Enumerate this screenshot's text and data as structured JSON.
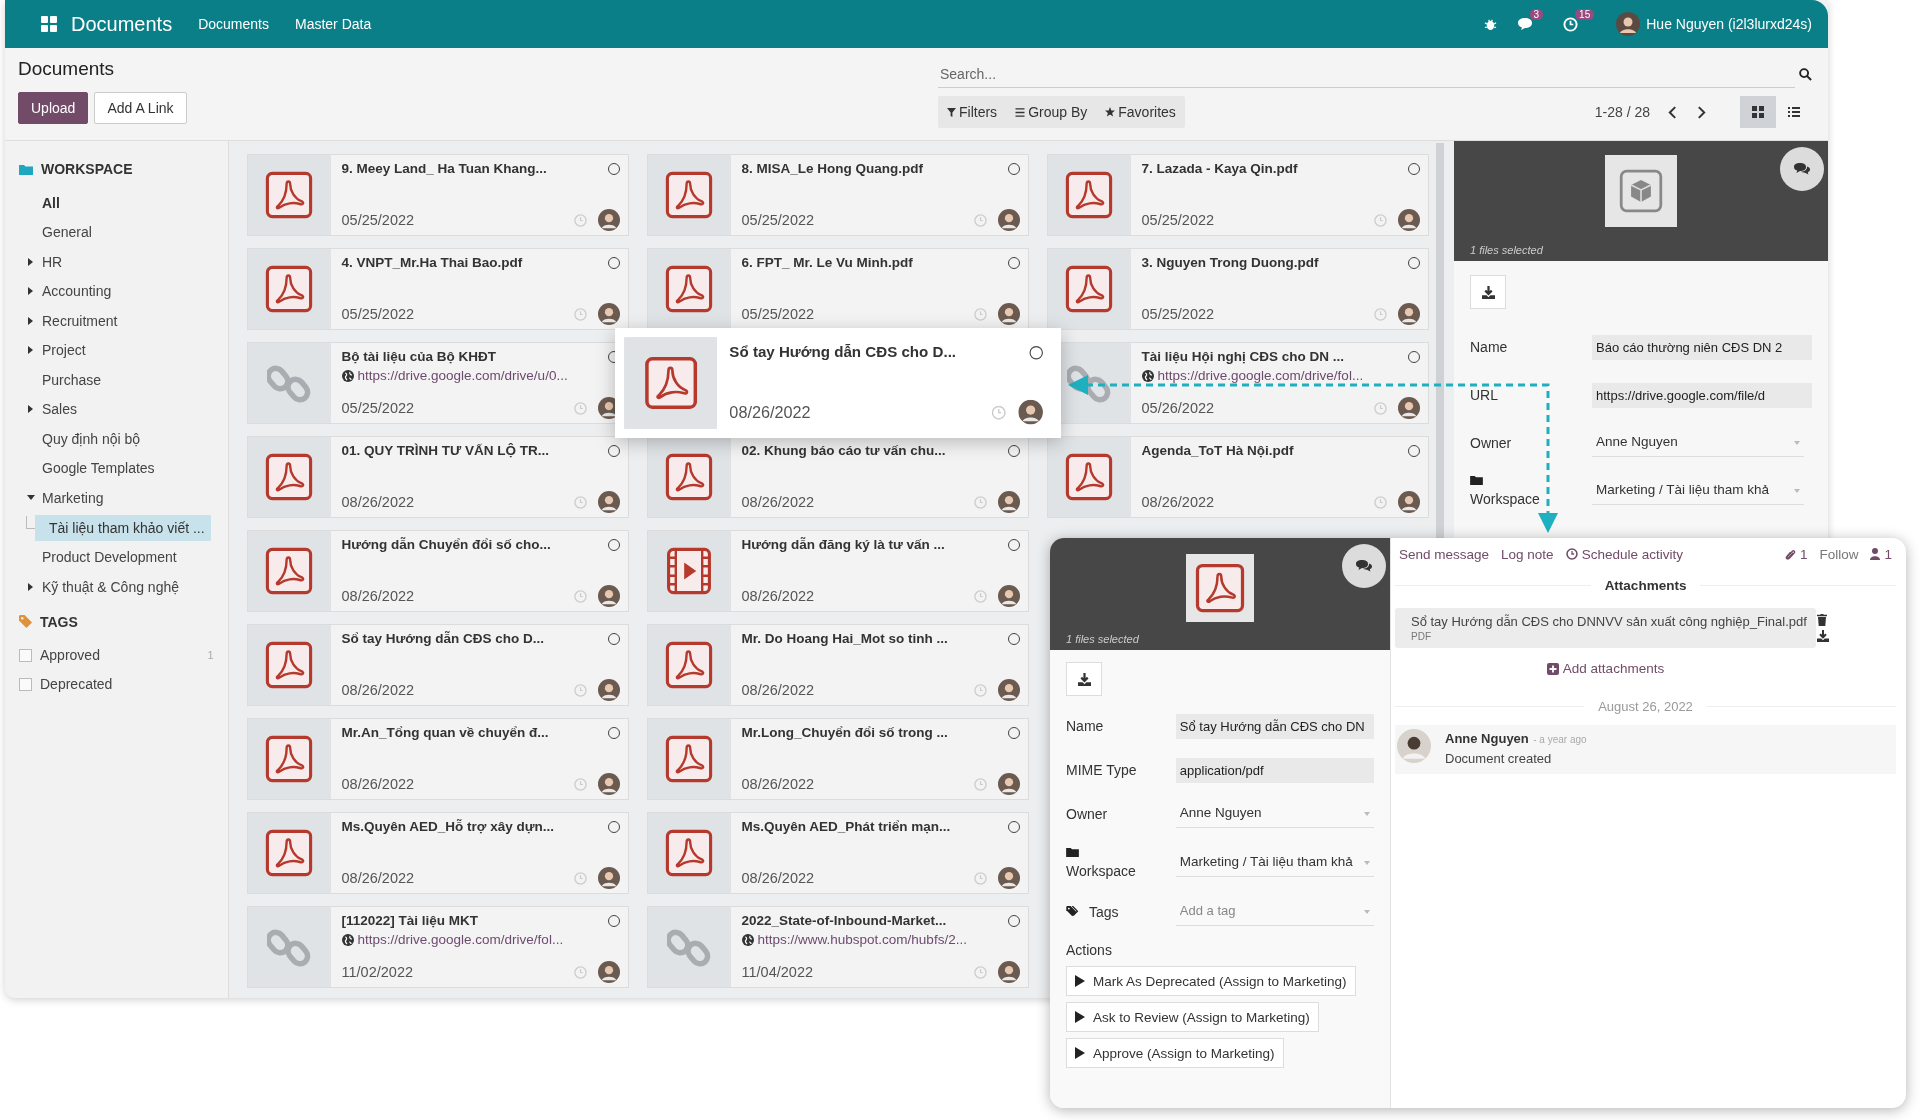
{
  "navbar": {
    "app_name": "Documents",
    "menus": [
      "Documents",
      "Master Data"
    ],
    "messages_count": "3",
    "activities_count": "15",
    "user": "Hue Nguyen (i2l3lurxd24s)"
  },
  "control_panel": {
    "title": "Documents",
    "buttons": [
      {
        "kind": "primary",
        "label": "Upload"
      },
      {
        "kind": "secondary",
        "label": "Add A Link"
      }
    ],
    "search": {
      "placeholder": "Search..."
    },
    "filters": [
      {
        "kind": "filter",
        "label": "Filters"
      },
      {
        "kind": "group",
        "label": "Group By"
      },
      {
        "kind": "star",
        "label": "Favorites"
      }
    ],
    "pager": "1-28 / 28",
    "views": [
      {
        "kind": "kanban",
        "selected": true
      },
      {
        "kind": "list",
        "selected": false
      }
    ]
  },
  "sidebar": {
    "workspace_heading": "WORKSPACE",
    "folders": [
      {
        "label": "All",
        "kind": "all",
        "expanded": false,
        "selected": false
      },
      {
        "label": "General",
        "kind": "leaf",
        "expanded": false,
        "selected": false
      },
      {
        "label": "HR",
        "kind": "group",
        "expanded": false,
        "selected": false
      },
      {
        "label": "Accounting",
        "kind": "group",
        "expanded": false,
        "selected": false
      },
      {
        "label": "Recruitment",
        "kind": "group",
        "expanded": false,
        "selected": false
      },
      {
        "label": "Project",
        "kind": "group",
        "expanded": false,
        "selected": false
      },
      {
        "label": "Purchase",
        "kind": "leaf",
        "expanded": false,
        "selected": false
      },
      {
        "label": "Sales",
        "kind": "group",
        "expanded": false,
        "selected": false
      },
      {
        "label": "Quy định nội bộ",
        "kind": "leaf",
        "expanded": false,
        "selected": false
      },
      {
        "label": "Google Templates",
        "kind": "leaf",
        "expanded": false,
        "selected": false
      },
      {
        "label": "Marketing",
        "kind": "group",
        "expanded": true,
        "selected": false,
        "children": [
          {
            "label": "Tài liệu tham khảo viết ...",
            "selected": true
          }
        ]
      },
      {
        "label": "Product Development",
        "kind": "leaf",
        "expanded": false,
        "selected": false
      },
      {
        "label": "Kỹ thuật & Công nghệ",
        "kind": "group",
        "expanded": false,
        "selected": false
      }
    ],
    "tags_heading": "TAGS",
    "tags": [
      {
        "label": "Approved",
        "count": "1",
        "checked": false
      },
      {
        "label": "Deprecated",
        "checked": false
      }
    ]
  },
  "card_columns": [
    {
      "cards": [
        {
          "kind": "pdf",
          "title": "9. Meey Land_ Ha Tuan Khang...",
          "date": "05/25/2022",
          "selected": false,
          "zoomed": false
        },
        {
          "kind": "pdf",
          "title": "4. VNPT_Mr.Ha Thai Bao.pdf",
          "date": "05/25/2022",
          "selected": false,
          "zoomed": false
        },
        {
          "kind": "link",
          "title": "Bộ tài liệu của Bộ KHĐT",
          "url": "https://drive.google.com/drive/u/0...",
          "date": "05/25/2022",
          "selected": false,
          "zoomed": false
        },
        {
          "kind": "pdf",
          "title": "01. QUY TRÌNH TƯ VẤN LỘ TR...",
          "date": "08/26/2022",
          "selected": false,
          "zoomed": false
        },
        {
          "kind": "pdf",
          "title": "Hướng dẫn Chuyển đổi số cho...",
          "date": "08/26/2022",
          "selected": false,
          "zoomed": false
        },
        {
          "kind": "pdf",
          "title": "Sổ tay Hướng dẫn CĐS cho D...",
          "date": "08/26/2022",
          "selected": false,
          "zoomed": false
        },
        {
          "kind": "pdf",
          "title": "Mr.An_Tổng quan về chuyển đ...",
          "date": "08/26/2022",
          "selected": false,
          "zoomed": false
        },
        {
          "kind": "pdf",
          "title": "Ms.Quyên AED_Hỗ trợ xây dựn...",
          "date": "08/26/2022",
          "selected": false,
          "zoomed": false
        },
        {
          "kind": "link",
          "title": "[112022] Tài liệu MKT",
          "url": "https://drive.google.com/drive/fol...",
          "date": "11/02/2022",
          "selected": false,
          "zoomed": false
        }
      ]
    },
    {
      "cards": [
        {
          "kind": "pdf",
          "title": "8. MISA_Le Hong Quang.pdf",
          "date": "05/25/2022",
          "selected": false,
          "zoomed": false
        },
        {
          "kind": "pdf",
          "title": "6. FPT_ Mr. Le Vu Minh.pdf",
          "date": "05/25/2022",
          "selected": false,
          "zoomed": false
        },
        {
          "kind": "pdf",
          "title": "Sổ tay Hướng dẫn CĐS cho D...",
          "date": "08/26/2022",
          "selected": false,
          "zoomed": true
        },
        {
          "kind": "pdf",
          "title": "02. Khung báo cáo tư vấn chu...",
          "date": "08/26/2022",
          "selected": false,
          "zoomed": false
        },
        {
          "kind": "video",
          "title": "Hướng dẫn đăng ký là tư vấn ...",
          "date": "08/26/2022",
          "selected": false,
          "zoomed": false
        },
        {
          "kind": "pdf",
          "title": "Mr. Do Hoang Hai_Mot so tinh ...",
          "date": "08/26/2022",
          "selected": false,
          "zoomed": false
        },
        {
          "kind": "pdf",
          "title": "Mr.Long_Chuyển đổi số trong ...",
          "date": "08/26/2022",
          "selected": false,
          "zoomed": false
        },
        {
          "kind": "pdf",
          "title": "Ms.Quyên AED_Phát triển mạn...",
          "date": "08/26/2022",
          "selected": false,
          "zoomed": false
        },
        {
          "kind": "link",
          "title": "2022_State-of-Inbound-Market...",
          "url": "https://www.hubspot.com/hubfs/2...",
          "date": "11/04/2022",
          "selected": false,
          "zoomed": false
        }
      ]
    },
    {
      "cards": [
        {
          "kind": "pdf",
          "title": "7. Lazada - Kaya Qin.pdf",
          "date": "05/25/2022",
          "selected": false,
          "zoomed": false
        },
        {
          "kind": "pdf",
          "title": "3. Nguyen Trong Duong.pdf",
          "date": "05/25/2022",
          "selected": false,
          "zoomed": false
        },
        {
          "kind": "link",
          "title": "Tài liệu Hội nghị CĐS cho DN ...",
          "url": "https://drive.google.com/drive/fol...",
          "date": "05/26/2022",
          "selected": false,
          "zoomed": false
        },
        {
          "kind": "pdf",
          "title": "Agenda_ToT Hà Nội.pdf",
          "date": "08/26/2022",
          "selected": false,
          "zoomed": false
        }
      ]
    }
  ],
  "details_panel": {
    "caption": "1 files selected",
    "fields": [
      {
        "kind": "readonly",
        "label": "Name",
        "value": "Báo cáo thường niên CĐS DN 2"
      },
      {
        "kind": "readonly",
        "label": "URL",
        "value": "https://drive.google.com/file/d"
      },
      {
        "kind": "select",
        "label": "Owner",
        "value": "Anne Nguyen"
      },
      {
        "kind": "workspace",
        "label": "Workspace",
        "value": "Marketing / Tài liệu tham khả"
      }
    ]
  },
  "details_popup": {
    "caption": "1 files selected",
    "fields": [
      {
        "kind": "readonly",
        "label": "Name",
        "value": "Sổ tay Hướng dẫn CĐS cho DN"
      },
      {
        "kind": "readonly",
        "label": "MIME Type",
        "value": "application/pdf"
      },
      {
        "kind": "select",
        "label": "Owner",
        "value": "Anne Nguyen"
      },
      {
        "kind": "workspace",
        "label": "Workspace",
        "value": "Marketing / Tài liệu tham khả"
      },
      {
        "kind": "tags",
        "label": "Tags",
        "placeholder": "Add a tag"
      }
    ],
    "actions_label": "Actions",
    "actions": [
      "Mark As Deprecated (Assign to Marketing)",
      "Ask to Review (Assign to Marketing)",
      "Approve (Assign to Marketing)"
    ],
    "chatter": {
      "buttons": [
        {
          "kind": "send",
          "label": "Send message"
        },
        {
          "kind": "note",
          "label": "Log note"
        },
        {
          "kind": "activity",
          "label": "Schedule activity"
        }
      ],
      "attachments_count": "1",
      "follow": "Follow",
      "followers_count": "1",
      "attachments_heading": "Attachments",
      "attachments": [
        {
          "name": "Sổ tay Hướng dẫn CĐS cho DNNVV sản xuất công nghiệp_Final.pdf",
          "type": "PDF"
        }
      ],
      "add_attachments": "Add attachments",
      "date_divider": "August 26, 2022",
      "messages": [
        {
          "author": "Anne Nguyen",
          "time": "- a year ago",
          "body": "Document created"
        }
      ]
    }
  }
}
